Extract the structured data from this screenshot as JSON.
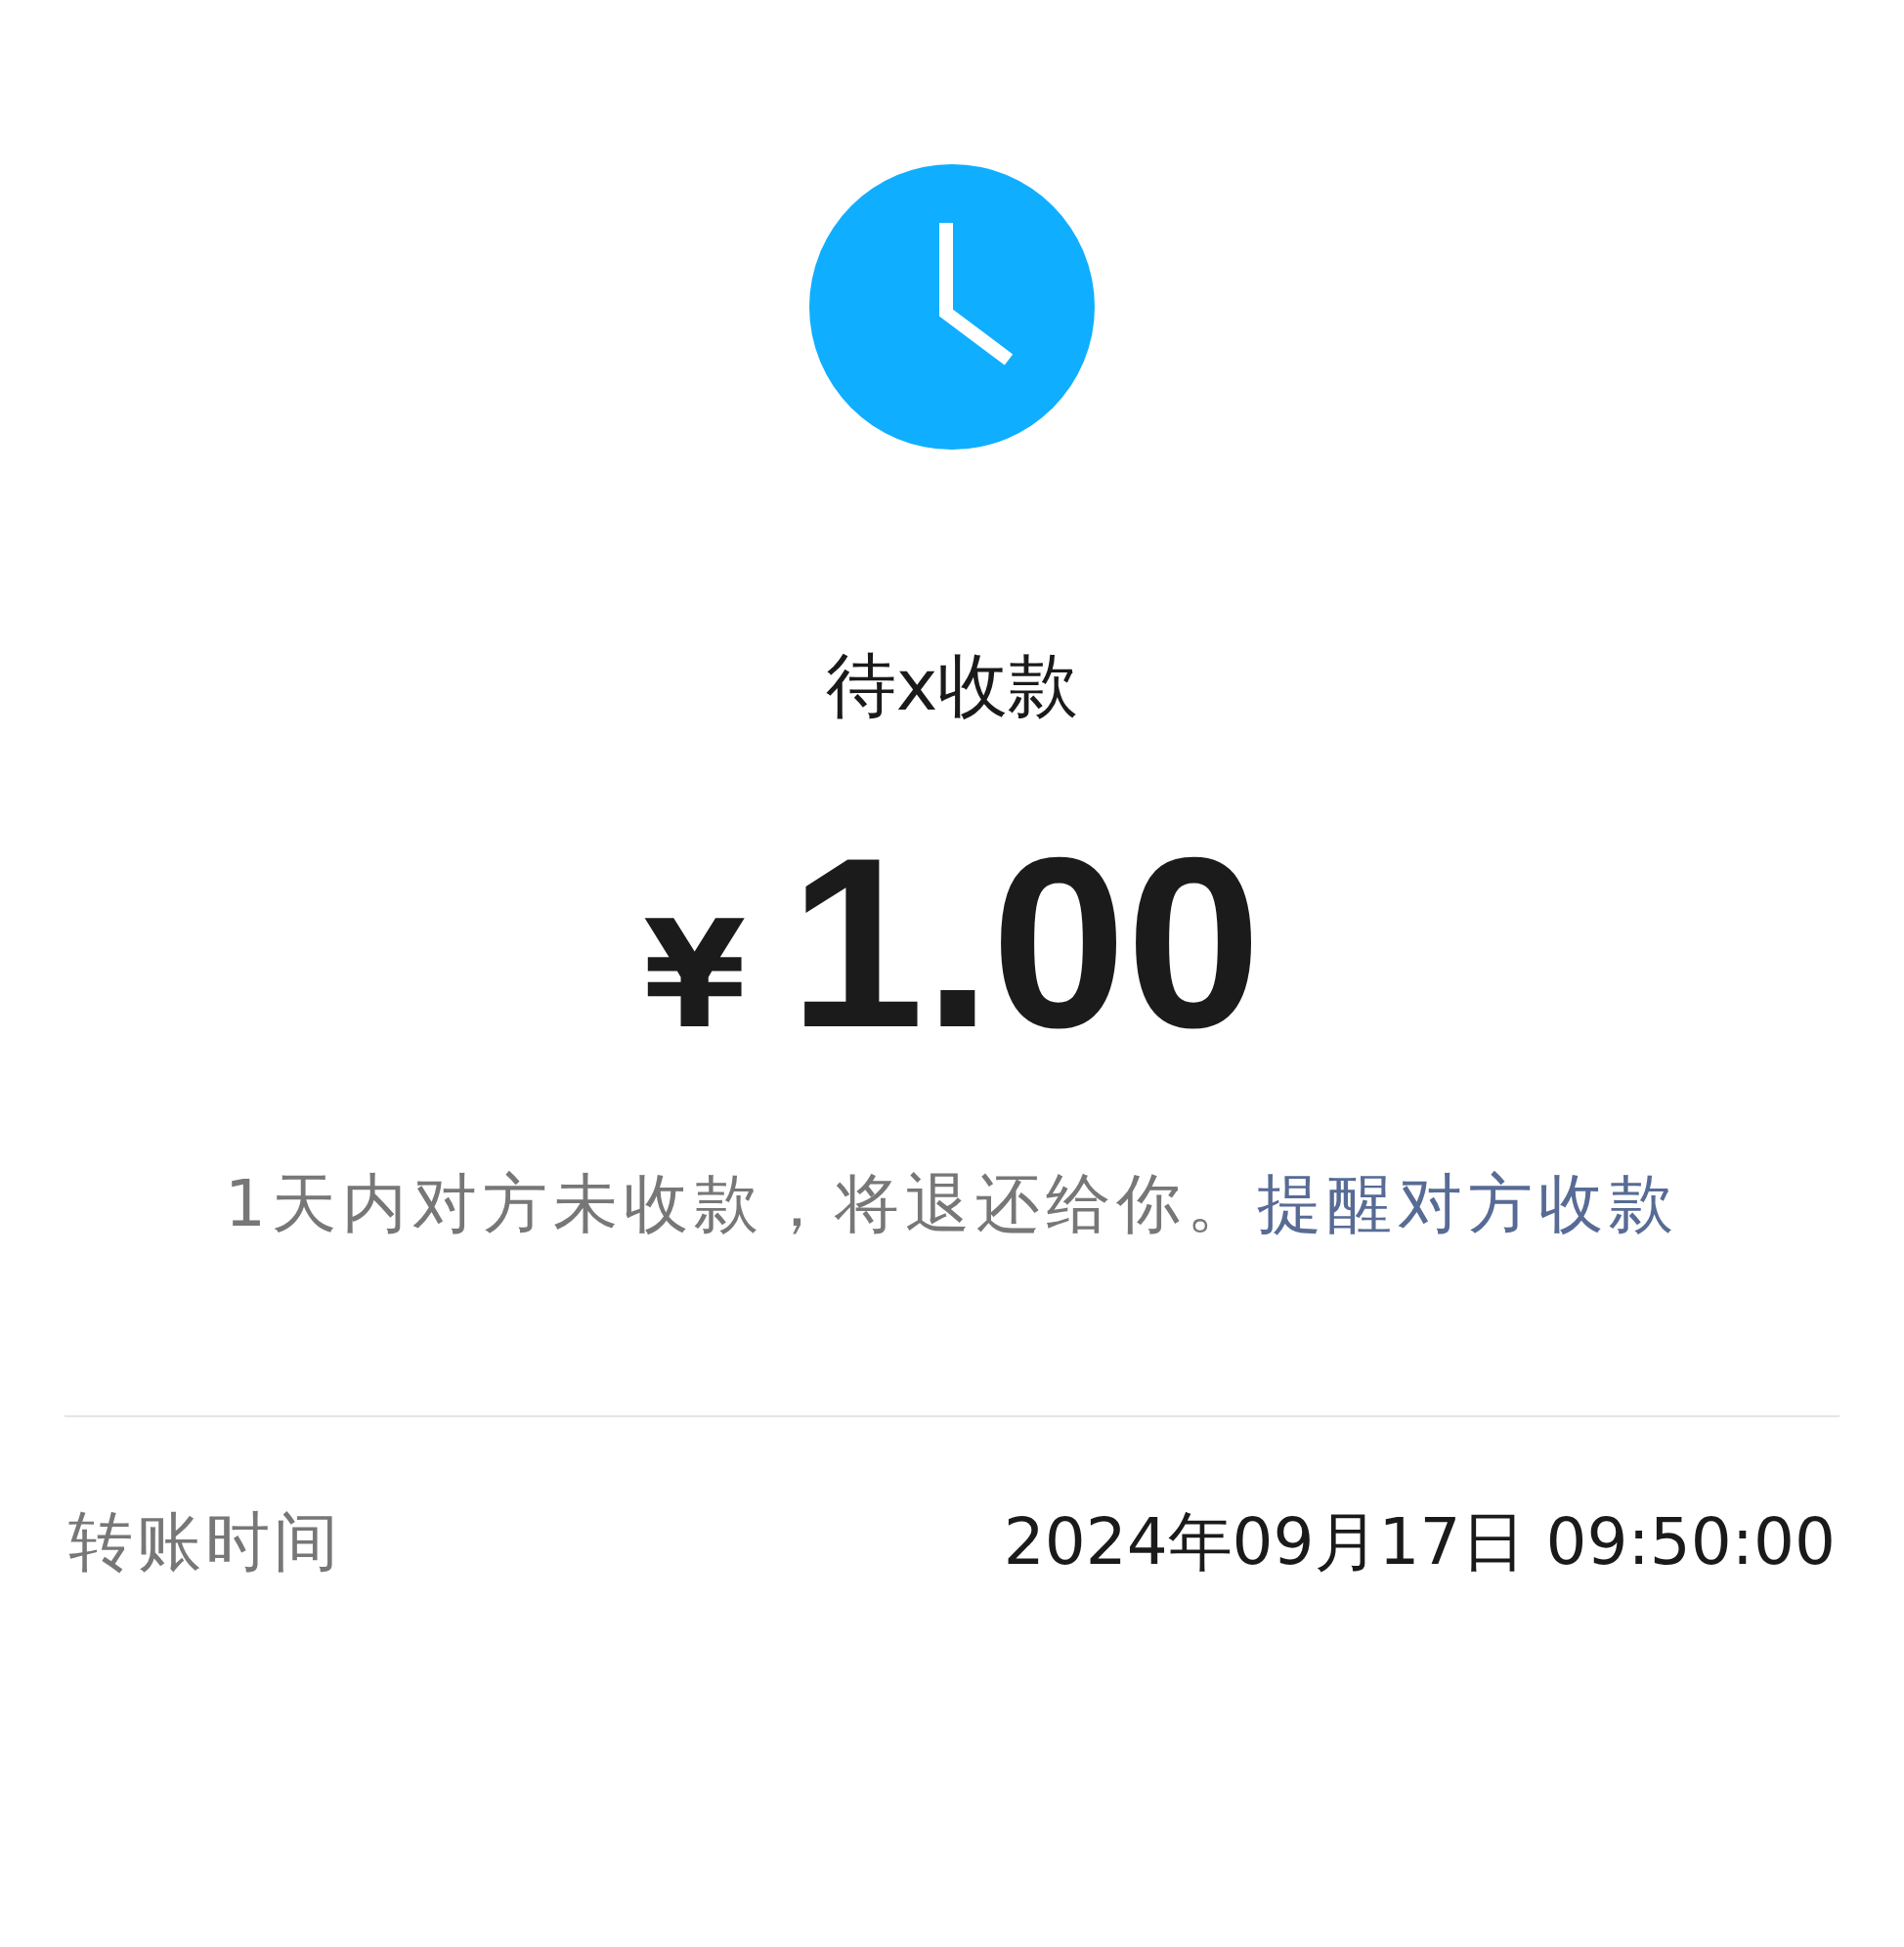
{
  "status": {
    "kind": "pending",
    "label": "待x收款"
  },
  "amount": {
    "currency": "¥",
    "value": "1.00"
  },
  "notice": {
    "text": "1天内对方未收款，将退还给你。",
    "link": "提醒对方收款"
  },
  "details": [
    {
      "label": "转账时间",
      "value": "2024年09月17日 09:50:00"
    }
  ]
}
